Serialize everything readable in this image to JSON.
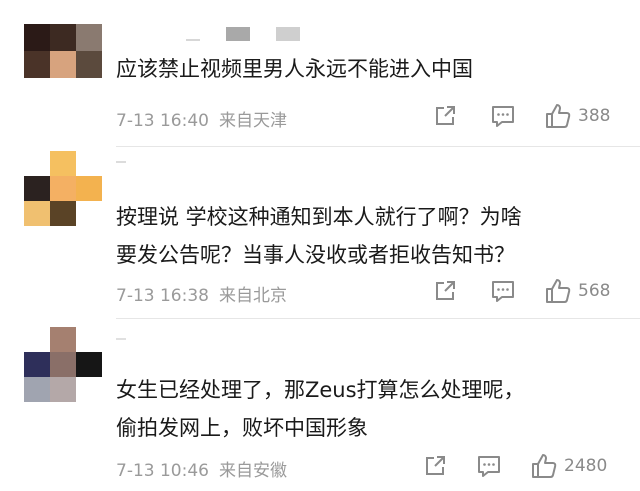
{
  "comments": [
    {
      "text_lines": [
        "应该禁止视频里男人永远不能进入中国"
      ],
      "time": "7-13 16:40",
      "location": "来自天津",
      "likes": "388",
      "avatar_colors": [
        "#2b1a17",
        "#3d2a22",
        "#8a7a70",
        "#4a3328",
        "#d7a37e",
        "#5b4a3d"
      ],
      "name_blocks": [
        "#d7d7d7",
        "#b8b8b8",
        "#cfcfcf"
      ]
    },
    {
      "text_lines": [
        "按理说 学校这种通知到本人就行了啊？为啥",
        "要发公告呢？当事人没收或者拒收告知书？"
      ],
      "time": "7-13 16:38",
      "location": "来自北京",
      "likes": "568",
      "avatar_colors": [
        "#ffffff",
        "#f5c060",
        "#ffffff",
        "#2b2220",
        "#f4b063",
        "#f3b24f",
        "#f0c070",
        "#5a4326",
        "#ffffff"
      ],
      "name_blocks": [
        "#dcdcdc"
      ]
    },
    {
      "text_lines": [
        "女生已经处理了，那Zeus打算怎么处理呢，",
        "偷拍发网上，败坏中国形象"
      ],
      "time": "7-13 10:46",
      "location": "来自安徽",
      "likes": "2480",
      "avatar_colors": [
        "#ffffff",
        "#a58070",
        "#ffffff",
        "#2e2f5a",
        "#8a6f68",
        "#161616",
        "#a0a4b0",
        "#b4a8a8",
        "#ffffff"
      ],
      "name_blocks": [
        "#e0e0e0"
      ]
    }
  ],
  "icons": {
    "share": "share-icon",
    "comment": "comment-icon",
    "like": "thumbs-up-icon"
  },
  "colors": {
    "text": "#1a1a1a",
    "meta": "#9a9a9a",
    "icon": "#8a8a8a",
    "divider": "#e6e6e6"
  }
}
